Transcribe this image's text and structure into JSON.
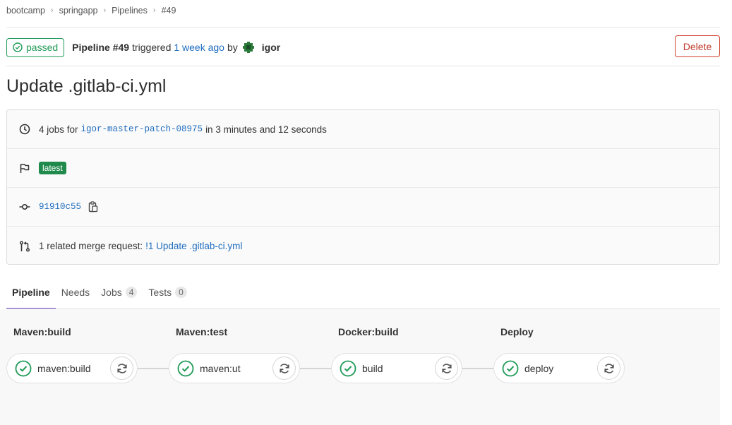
{
  "breadcrumb": [
    "bootcamp",
    "springapp",
    "Pipelines",
    "#49"
  ],
  "header": {
    "status": "passed",
    "pipeline_label": "Pipeline #49",
    "triggered": "triggered",
    "time": "1 week ago",
    "by": "by",
    "user": "igor",
    "delete_label": "Delete"
  },
  "title": "Update .gitlab-ci.yml",
  "info": {
    "jobs_prefix": "4 jobs for",
    "branch": "igor-master-patch-08975",
    "duration": "in 3 minutes and 12 seconds",
    "badge": "latest",
    "sha": "91910c55",
    "mr_prefix": "1 related merge request:",
    "mr_link": "!1 Update .gitlab-ci.yml"
  },
  "tabs": [
    {
      "label": "Pipeline",
      "count": null
    },
    {
      "label": "Needs",
      "count": null
    },
    {
      "label": "Jobs",
      "count": "4"
    },
    {
      "label": "Tests",
      "count": "0"
    }
  ],
  "stages": [
    {
      "title": "Maven:build",
      "job": "maven:build",
      "status": "passed"
    },
    {
      "title": "Maven:test",
      "job": "maven:ut",
      "status": "passed"
    },
    {
      "title": "Docker:build",
      "job": "build",
      "status": "passed"
    },
    {
      "title": "Deploy",
      "job": "deploy",
      "status": "passed"
    }
  ],
  "colors": {
    "success": "#1f9a57",
    "link": "#1f6dbf",
    "danger": "#d0402b",
    "tab_active": "#6e49cb"
  }
}
